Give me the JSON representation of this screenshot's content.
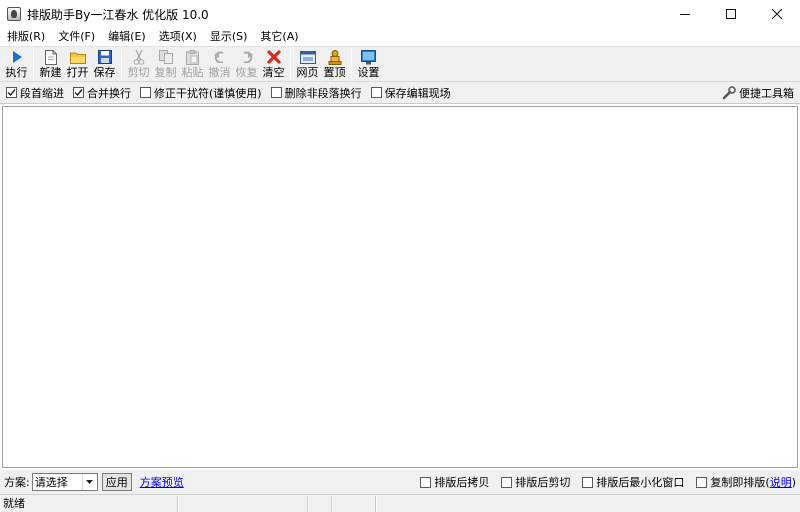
{
  "window": {
    "title": "排版助手By一江春水 优化版 10.0",
    "minimize_icon": "minimize-icon",
    "maximize_icon": "maximize-icon",
    "close_icon": "close-icon"
  },
  "menubar": {
    "items": [
      {
        "label": "排版(R)"
      },
      {
        "label": "文件(F)"
      },
      {
        "label": "编辑(E)"
      },
      {
        "label": "选项(X)"
      },
      {
        "label": "显示(S)"
      },
      {
        "label": "其它(A)"
      }
    ]
  },
  "toolbar": {
    "execute": {
      "label": "执行",
      "icon": "play-icon",
      "color": "#1f6fd1"
    },
    "new": {
      "label": "新建",
      "icon": "new-document-icon"
    },
    "open": {
      "label": "打开",
      "icon": "open-folder-icon"
    },
    "save": {
      "label": "保存",
      "icon": "save-icon"
    },
    "cut": {
      "label": "剪切",
      "icon": "scissors-icon"
    },
    "copy": {
      "label": "复制",
      "icon": "copy-icon"
    },
    "paste": {
      "label": "粘贴",
      "icon": "paste-icon"
    },
    "undo": {
      "label": "撤消",
      "icon": "undo-icon"
    },
    "redo": {
      "label": "恢复",
      "icon": "redo-icon"
    },
    "clear": {
      "label": "清空",
      "icon": "clear-x-icon",
      "color": "#d62b1e"
    },
    "webpage": {
      "label": "网页",
      "icon": "webpage-icon"
    },
    "pin_top": {
      "label": "置顶",
      "icon": "pin-top-icon"
    },
    "settings": {
      "label": "设置",
      "icon": "settings-monitor-icon"
    }
  },
  "options": {
    "indent": {
      "label": "段首缩进",
      "checked": true
    },
    "merge_lines": {
      "label": "合并换行",
      "checked": true
    },
    "fix_interference": {
      "label": "修正干扰符(谨慎使用)",
      "checked": false
    },
    "delete_non_paragraph": {
      "label": "删除非段落换行",
      "checked": false
    },
    "keep_edit_state": {
      "label": "保存编辑现场",
      "checked": false
    },
    "toolbox": {
      "label": "便捷工具箱",
      "icon": "wrench-icon"
    }
  },
  "editor": {
    "content": ""
  },
  "scheme": {
    "label": "方案:",
    "select_value": "请选择",
    "apply_label": "应用",
    "preview_link": "方案预览",
    "copy_after": {
      "label": "排版后拷贝",
      "checked": false
    },
    "cut_after": {
      "label": "排版后剪切",
      "checked": false
    },
    "minimize_after": {
      "label": "排版后最小化窗口",
      "checked": false
    },
    "copy_then_format_prefix": "复制即排版(",
    "explain_link": "说明",
    "copy_then_format_suffix": ")",
    "copy_then_format_checked": false
  },
  "status": {
    "text": "就绪"
  }
}
